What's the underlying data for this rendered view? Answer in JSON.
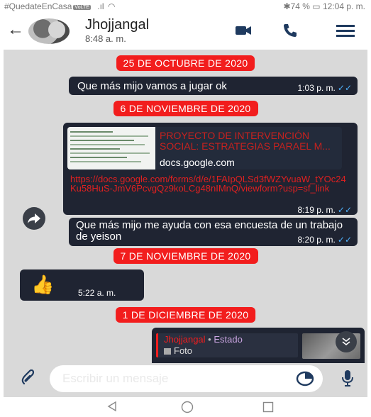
{
  "status_bar": {
    "left_text": "#QuedateEnCasa",
    "mini_badge": "VoLTE",
    "battery_time": "✱74 % ▭ 12:04 p. m."
  },
  "header": {
    "contact_name": "Jhojjangal",
    "last_seen": "8:48 a. m."
  },
  "messages": {
    "date1": "25 DE OCTUBRE DE 2020",
    "msg1_text": "Que más mijo vamos a jugar ok",
    "msg1_time": "1:03 p. m.",
    "date2": "6 DE NOVIEMBRE DE 2020",
    "preview_title": "PROYECTO DE INTERVENCIÓN SOCIAL: ESTRATEGIAS PARAEL M...",
    "preview_domain": "docs.google.com",
    "link_text": "https://docs.google.com/forms/d/e/1FAIpQLSd3fWZYvuaW_tYOc24Ku58HuS-JmV6PcvgQz9koLCg48nIMnQ/viewform?usp=sf_link",
    "link_time": "8:19 p. m.",
    "msg3_text": "Que más mijo me ayuda con esa encuesta de un trabajo de yeison",
    "msg3_time": "8:20 p. m.",
    "date3": "7 DE NOVIEMBRE DE 2020",
    "thumbs_time": "5:22 a. m.",
    "date4": "1 DE DICIEMBRE DE 2020",
    "reply_author": "Jhojjangal",
    "reply_sep": "•",
    "reply_status": "Estado",
    "reply_label": "Foto"
  },
  "composer": {
    "placeholder": "Escribir un mensaje"
  },
  "colors": {
    "accent": "#f21d1d",
    "bubble": "#1f2432",
    "read_tick": "#4fb3ff",
    "chat_bg": "#d9d9d9"
  },
  "icons": [
    "back-arrow-icon",
    "video-call-icon",
    "phone-icon",
    "menu-icon",
    "share-icon",
    "attach-icon",
    "sticker-icon",
    "mic-icon",
    "scroll-down-icon",
    "nav-back-icon",
    "nav-home-icon",
    "nav-recent-icon"
  ]
}
